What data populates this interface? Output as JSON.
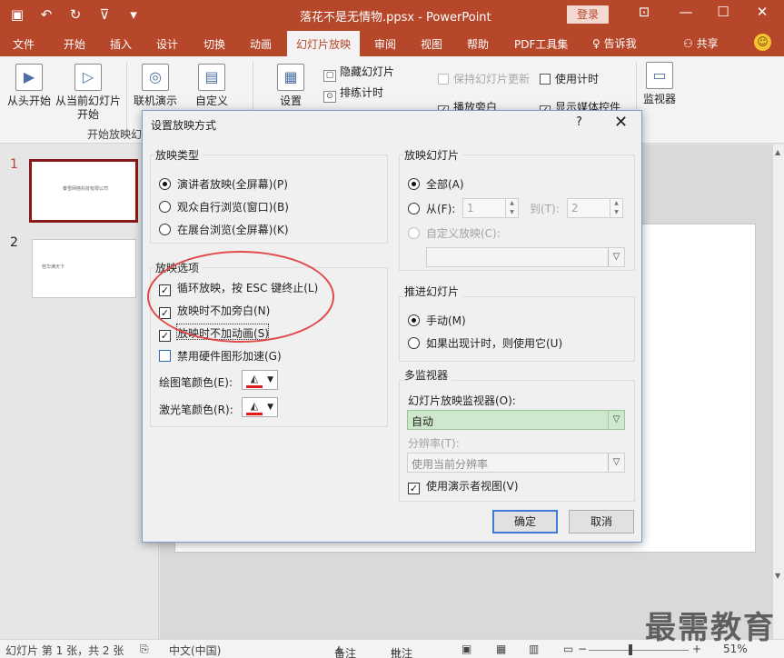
{
  "titlebar": {
    "doc_title": "落花不是无情物.ppsx  -  PowerPoint",
    "login_label": "登录",
    "qat_icons": [
      "save-icon",
      "undo-icon",
      "redo-icon",
      "presenter-icon",
      "customize-icon"
    ],
    "qat_glyphs": [
      "▣",
      "↶",
      "↻",
      "⊽",
      "▾"
    ],
    "win_glyphs": [
      "⊡",
      "—",
      "☐",
      "✕"
    ]
  },
  "tabs": [
    "文件",
    "开始",
    "插入",
    "设计",
    "切换",
    "动画",
    "幻灯片放映",
    "审阅",
    "视图",
    "帮助",
    "PDF工具集"
  ],
  "active_tab": "幻灯片放映",
  "tell_me": "告诉我",
  "share": "共享",
  "ribbon": {
    "from_beginning": "从头开始",
    "from_current": "从当前幻灯片开始",
    "present_online": "联机演示",
    "custom": "自定义",
    "group_start": "开始放映幻",
    "setup": "设置",
    "hide_slide": "隐藏幻灯片",
    "rehearse": "排练计时",
    "keep_updated": "保持幻灯片更新",
    "use_timings": "使用计时",
    "play_narrations": "播放旁白",
    "show_media": "显示媒体控件",
    "monitor": "监视器"
  },
  "thumbnails": [
    {
      "num": "1",
      "text": "秦雪网络科技有限公司"
    },
    {
      "num": "2",
      "text": "桂华满天下"
    }
  ],
  "dialog": {
    "title": "设置放映方式",
    "help": "?",
    "close": "✕",
    "show_type": {
      "title": "放映类型",
      "options": [
        "演讲者放映(全屏幕)(P)",
        "观众自行浏览(窗口)(B)",
        "在展台浏览(全屏幕)(K)"
      ],
      "selected": 0
    },
    "show_options": {
      "title": "放映选项",
      "items": [
        {
          "label": "循环放映，按 ESC 键终止(L)",
          "checked": true
        },
        {
          "label": "放映时不加旁白(N)",
          "checked": true
        },
        {
          "label": "放映时不加动画(S)",
          "checked": true
        },
        {
          "label": "禁用硬件图形加速(G)",
          "checked": false
        }
      ],
      "pen_color": "绘图笔颜色(E):",
      "laser_color": "激光笔颜色(R):"
    },
    "show_slides": {
      "title": "放映幻灯片",
      "all": "全部(A)",
      "from": "从(F):",
      "from_value": "1",
      "to": "到(T):",
      "to_value": "2",
      "custom": "自定义放映(C):",
      "custom_value": ""
    },
    "advance": {
      "title": "推进幻灯片",
      "manual": "手动(M)",
      "timings": "如果出现计时，则使用它(U)"
    },
    "monitors": {
      "title": "多监视器",
      "monitor_label": "幻灯片放映监视器(O):",
      "monitor_value": "自动",
      "resolution_label": "分辨率(T):",
      "resolution_value": "使用当前分辨率",
      "presenter_view": "使用演示者视图(V)"
    },
    "ok": "确定",
    "cancel": "取消"
  },
  "statusbar": {
    "slide_info": "幻灯片 第 1 张，共 2 张",
    "language": "中文(中国)",
    "notes": "备注",
    "comments": "批注",
    "zoom": "51%"
  },
  "watermark": "最需教育",
  "colors": {
    "accent": "#b7472a",
    "annotation": "#e04a4a",
    "pen": "#e01b1b"
  }
}
